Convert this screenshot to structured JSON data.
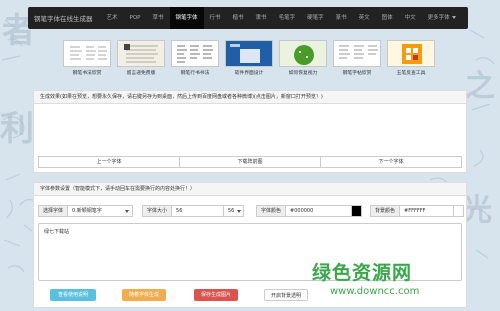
{
  "navbar": {
    "brand": "钢笔字体在线生成器",
    "items": [
      {
        "label": "艺术",
        "active": false
      },
      {
        "label": "POP",
        "active": false
      },
      {
        "label": "草书",
        "active": false
      },
      {
        "label": "钢笔字体",
        "active": true
      },
      {
        "label": "行书",
        "active": false
      },
      {
        "label": "楷书",
        "active": false
      },
      {
        "label": "隶书",
        "active": false
      },
      {
        "label": "毛笔字",
        "active": false
      },
      {
        "label": "硬笔字",
        "active": false
      },
      {
        "label": "篆书",
        "active": false
      },
      {
        "label": "英文",
        "active": false
      },
      {
        "label": "图体",
        "active": false
      },
      {
        "label": "中文",
        "active": false
      },
      {
        "label": "更多字体",
        "active": false,
        "dropdown": true
      }
    ]
  },
  "thumbnails": [
    {
      "label": "钢笔书法欣赏"
    },
    {
      "label": "留言递免费版"
    },
    {
      "label": "钢笔行书书法"
    },
    {
      "label": "软件界面设计"
    },
    {
      "label": "如何恢复视力"
    },
    {
      "label": "钢笔字帖欣赏"
    },
    {
      "label": "五笔反查工具"
    }
  ],
  "preview_panel": {
    "heading": "生成效果(如果在预览，想要永久保存，请右键另存为到桌面，然后上传到百度网盘或者各种微博)(点击图片，新窗口打开预览！)",
    "buttons": {
      "prev": "上一个字体",
      "download": "下载阵前图",
      "next": "下一个字体"
    }
  },
  "settings_panel": {
    "heading": "字体参数设置（智能模式下，请手动回车在需要换行的内容处换行！）",
    "select_font_label": "选择字体",
    "select_font_value": "0.新颖钢笔字",
    "font_size_label": "字体大小",
    "font_size_value": "56",
    "font_size_select": "56",
    "font_color_label": "字体颜色",
    "font_color_value": "#000000",
    "bg_color_label": "背景颜色",
    "bg_color_value": "#FFFFFF",
    "text_content": "绿七下载站",
    "actions": {
      "help": "查看使用说明",
      "random": "随着字体生成",
      "generate": "保存生成图片",
      "transparent": "开启背景透明"
    }
  },
  "watermark": {
    "title": "绿色资源网",
    "url": "www.downcc.com"
  },
  "colors": {
    "help": "#5bc0de",
    "random": "#f0ad4e",
    "generate": "#d9534f"
  }
}
